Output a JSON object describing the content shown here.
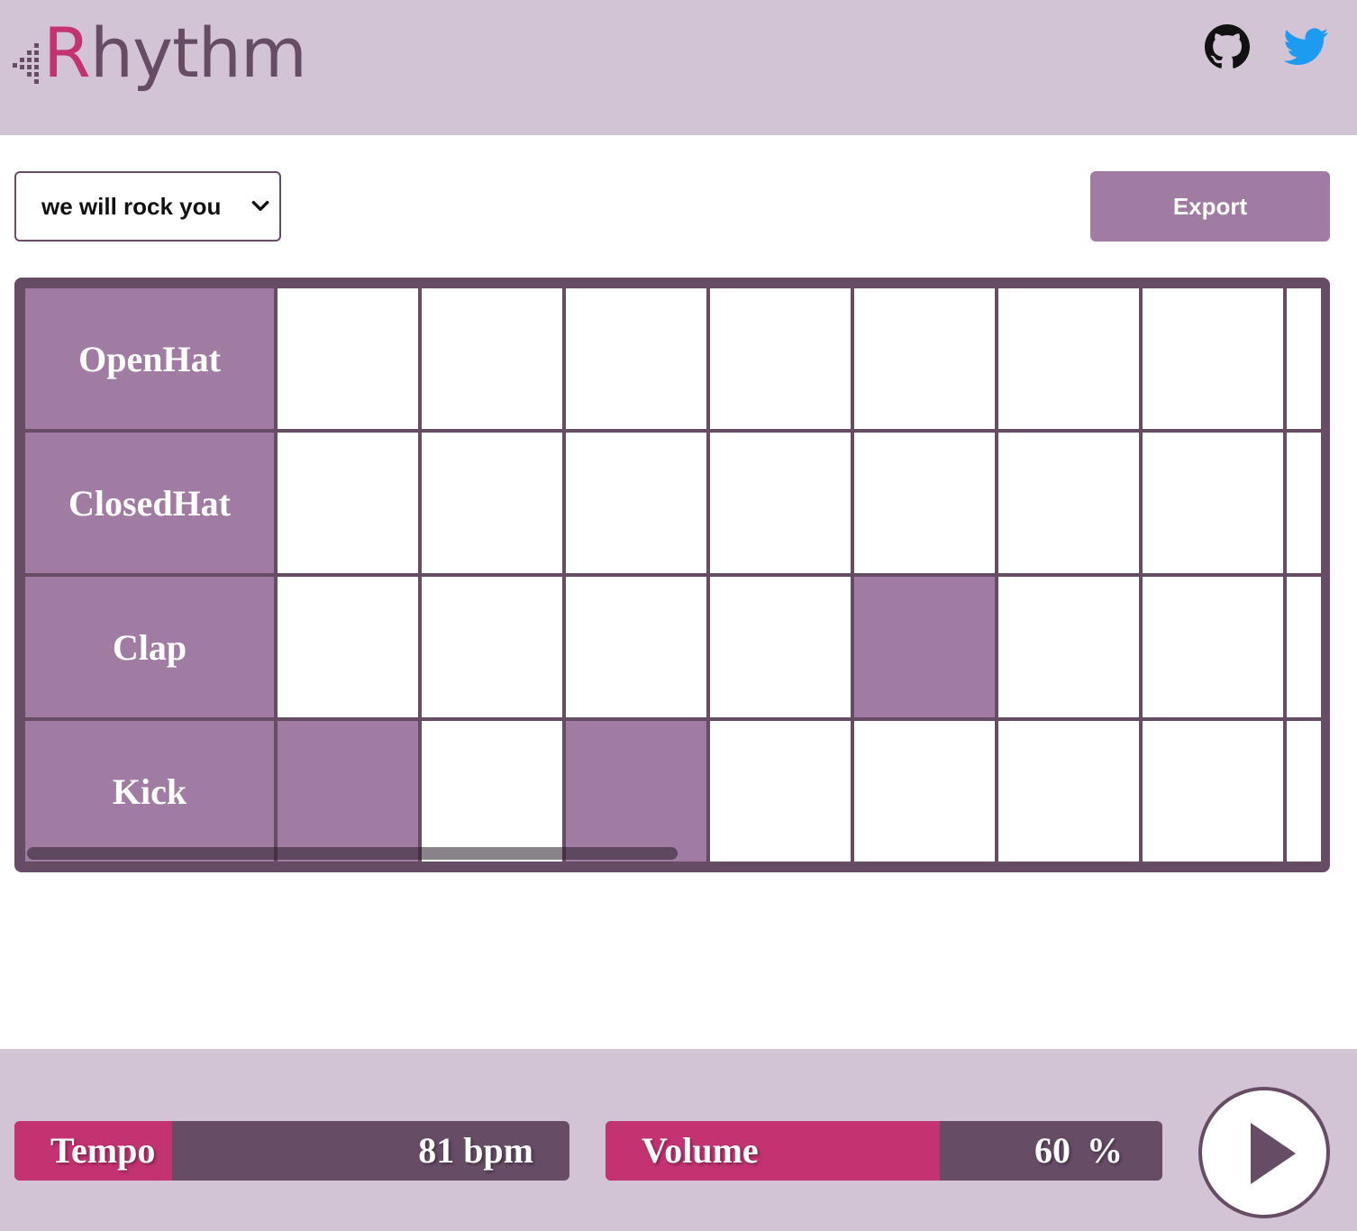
{
  "app": {
    "logo_text": "Rhythm"
  },
  "header": {
    "github_icon": "github-icon",
    "twitter_icon": "twitter-icon"
  },
  "toolbar": {
    "preset_value": "we will rock you",
    "export_label": "Export"
  },
  "sequencer": {
    "tracks": [
      {
        "name": "OpenHat",
        "steps": [
          false,
          false,
          false,
          false,
          false,
          false,
          false,
          false
        ]
      },
      {
        "name": "ClosedHat",
        "steps": [
          false,
          false,
          false,
          false,
          false,
          false,
          false,
          false
        ]
      },
      {
        "name": "Clap",
        "steps": [
          false,
          false,
          false,
          false,
          true,
          false,
          false,
          false
        ]
      },
      {
        "name": "Kick",
        "steps": [
          true,
          false,
          true,
          false,
          false,
          false,
          false,
          false
        ]
      }
    ]
  },
  "controls": {
    "tempo": {
      "label": "Tempo",
      "display": "81 bpm",
      "value": 81,
      "fill_fraction": 0.28
    },
    "volume": {
      "label": "Volume",
      "display": "60 %",
      "value": 60,
      "fill_fraction": 0.6
    },
    "play_icon": "play-icon"
  },
  "colors": {
    "accent": "#a07ca3",
    "dark": "#674c66",
    "pink": "#c33371",
    "header_bg": "#d2c4d4",
    "twitter": "#1d9bf0"
  }
}
